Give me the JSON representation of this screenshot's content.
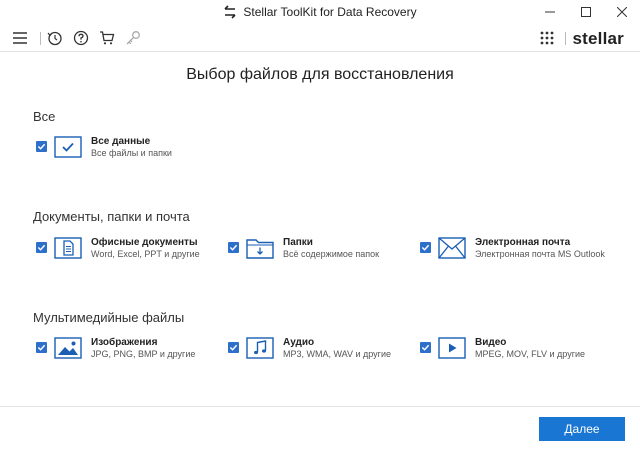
{
  "window": {
    "title": "Stellar ToolKit for Data Recovery",
    "minimize_glyph": "—",
    "maximize_glyph": "☐",
    "close_glyph": "✕"
  },
  "toolbar": {
    "icons": [
      "menu-icon",
      "history-icon",
      "help-icon",
      "cart-icon",
      "key-icon",
      "apps-grid-icon"
    ],
    "brand": "stellar"
  },
  "page": {
    "title": "Выбор файлов для восстановления"
  },
  "sections": [
    {
      "title": "Все",
      "options": [
        {
          "label": "Все данные",
          "desc": "Все файлы и папки",
          "checked": true,
          "icon": "checkmark-box-icon"
        }
      ]
    },
    {
      "title": "Документы, папки и почта",
      "options": [
        {
          "label": "Офисные документы",
          "desc": "Word, Excel, PPT и другие",
          "checked": true,
          "icon": "document-icon"
        },
        {
          "label": "Папки",
          "desc": "Всё содержимое папок",
          "checked": true,
          "icon": "folder-icon"
        },
        {
          "label": "Электронная почта",
          "desc": "Электронная почта MS Outlook",
          "checked": true,
          "icon": "envelope-icon"
        }
      ]
    },
    {
      "title": "Мультимедийные файлы",
      "options": [
        {
          "label": "Изображения",
          "desc": "JPG, PNG, BMP и другие",
          "checked": true,
          "icon": "image-icon"
        },
        {
          "label": "Аудио",
          "desc": "MP3, WMA, WAV и другие",
          "checked": true,
          "icon": "music-note-icon"
        },
        {
          "label": "Видео",
          "desc": "MPEG, MOV, FLV и другие",
          "checked": true,
          "icon": "video-play-icon"
        }
      ]
    }
  ],
  "footer": {
    "next_label": "Далее"
  },
  "colors": {
    "accent": "#1976d2",
    "checkbox": "#2d6fc9",
    "icon_stroke": "#1a5fb4"
  }
}
